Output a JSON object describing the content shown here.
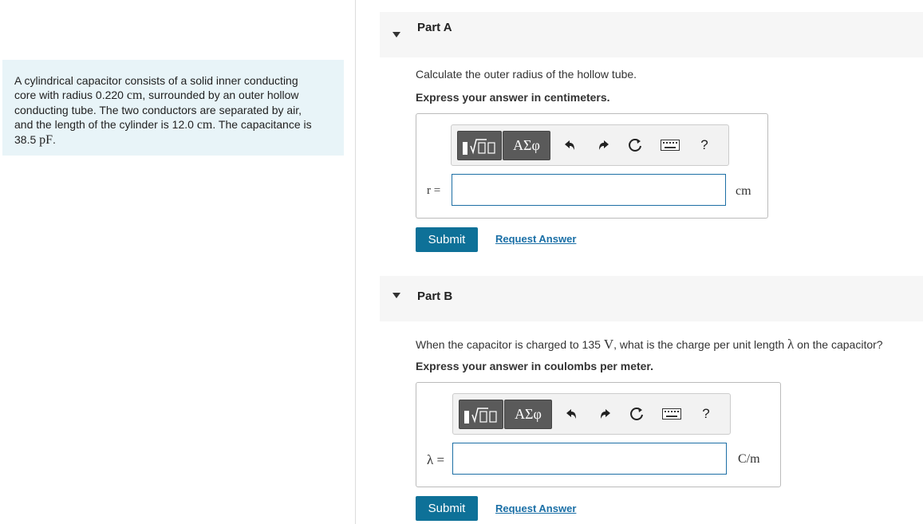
{
  "problem": {
    "line1": "A cylindrical capacitor consists of a solid inner conducting",
    "line2_a": "core with radius 0.220 ",
    "line2_unit": "cm",
    "line2_b": ", surrounded by an outer hollow",
    "line3": "conducting tube. The two conductors are separated by air,",
    "line4_a": "and the length of the cylinder is 12.0 ",
    "line4_unit": "cm",
    "line4_b": ". The capacitance is",
    "line5_a": "38.5 ",
    "line5_unit": "pF",
    "line5_b": "."
  },
  "partA": {
    "title": "Part A",
    "question": "Calculate the outer radius of the hollow tube.",
    "express": "Express your answer in centimeters.",
    "variable": "r =",
    "input_value": "",
    "unit": "cm",
    "submit": "Submit",
    "request": "Request Answer"
  },
  "partB": {
    "title": "Part B",
    "question_a": "When the capacitor is charged to 135 ",
    "question_unit": "V",
    "question_b": ", what is the charge per unit length ",
    "question_sym": "λ",
    "question_c": " on the capacitor?",
    "express": "Express your answer in coulombs per meter.",
    "variable": "λ =",
    "input_value": "",
    "unit": "C/m",
    "submit": "Submit",
    "request": "Request Answer"
  },
  "toolbar": {
    "greek": "ΑΣφ",
    "help": "?",
    "icons": [
      "templates-icon",
      "greek-symbols-icon",
      "undo-icon",
      "redo-icon",
      "reset-icon",
      "keyboard-icon",
      "help-icon"
    ]
  }
}
